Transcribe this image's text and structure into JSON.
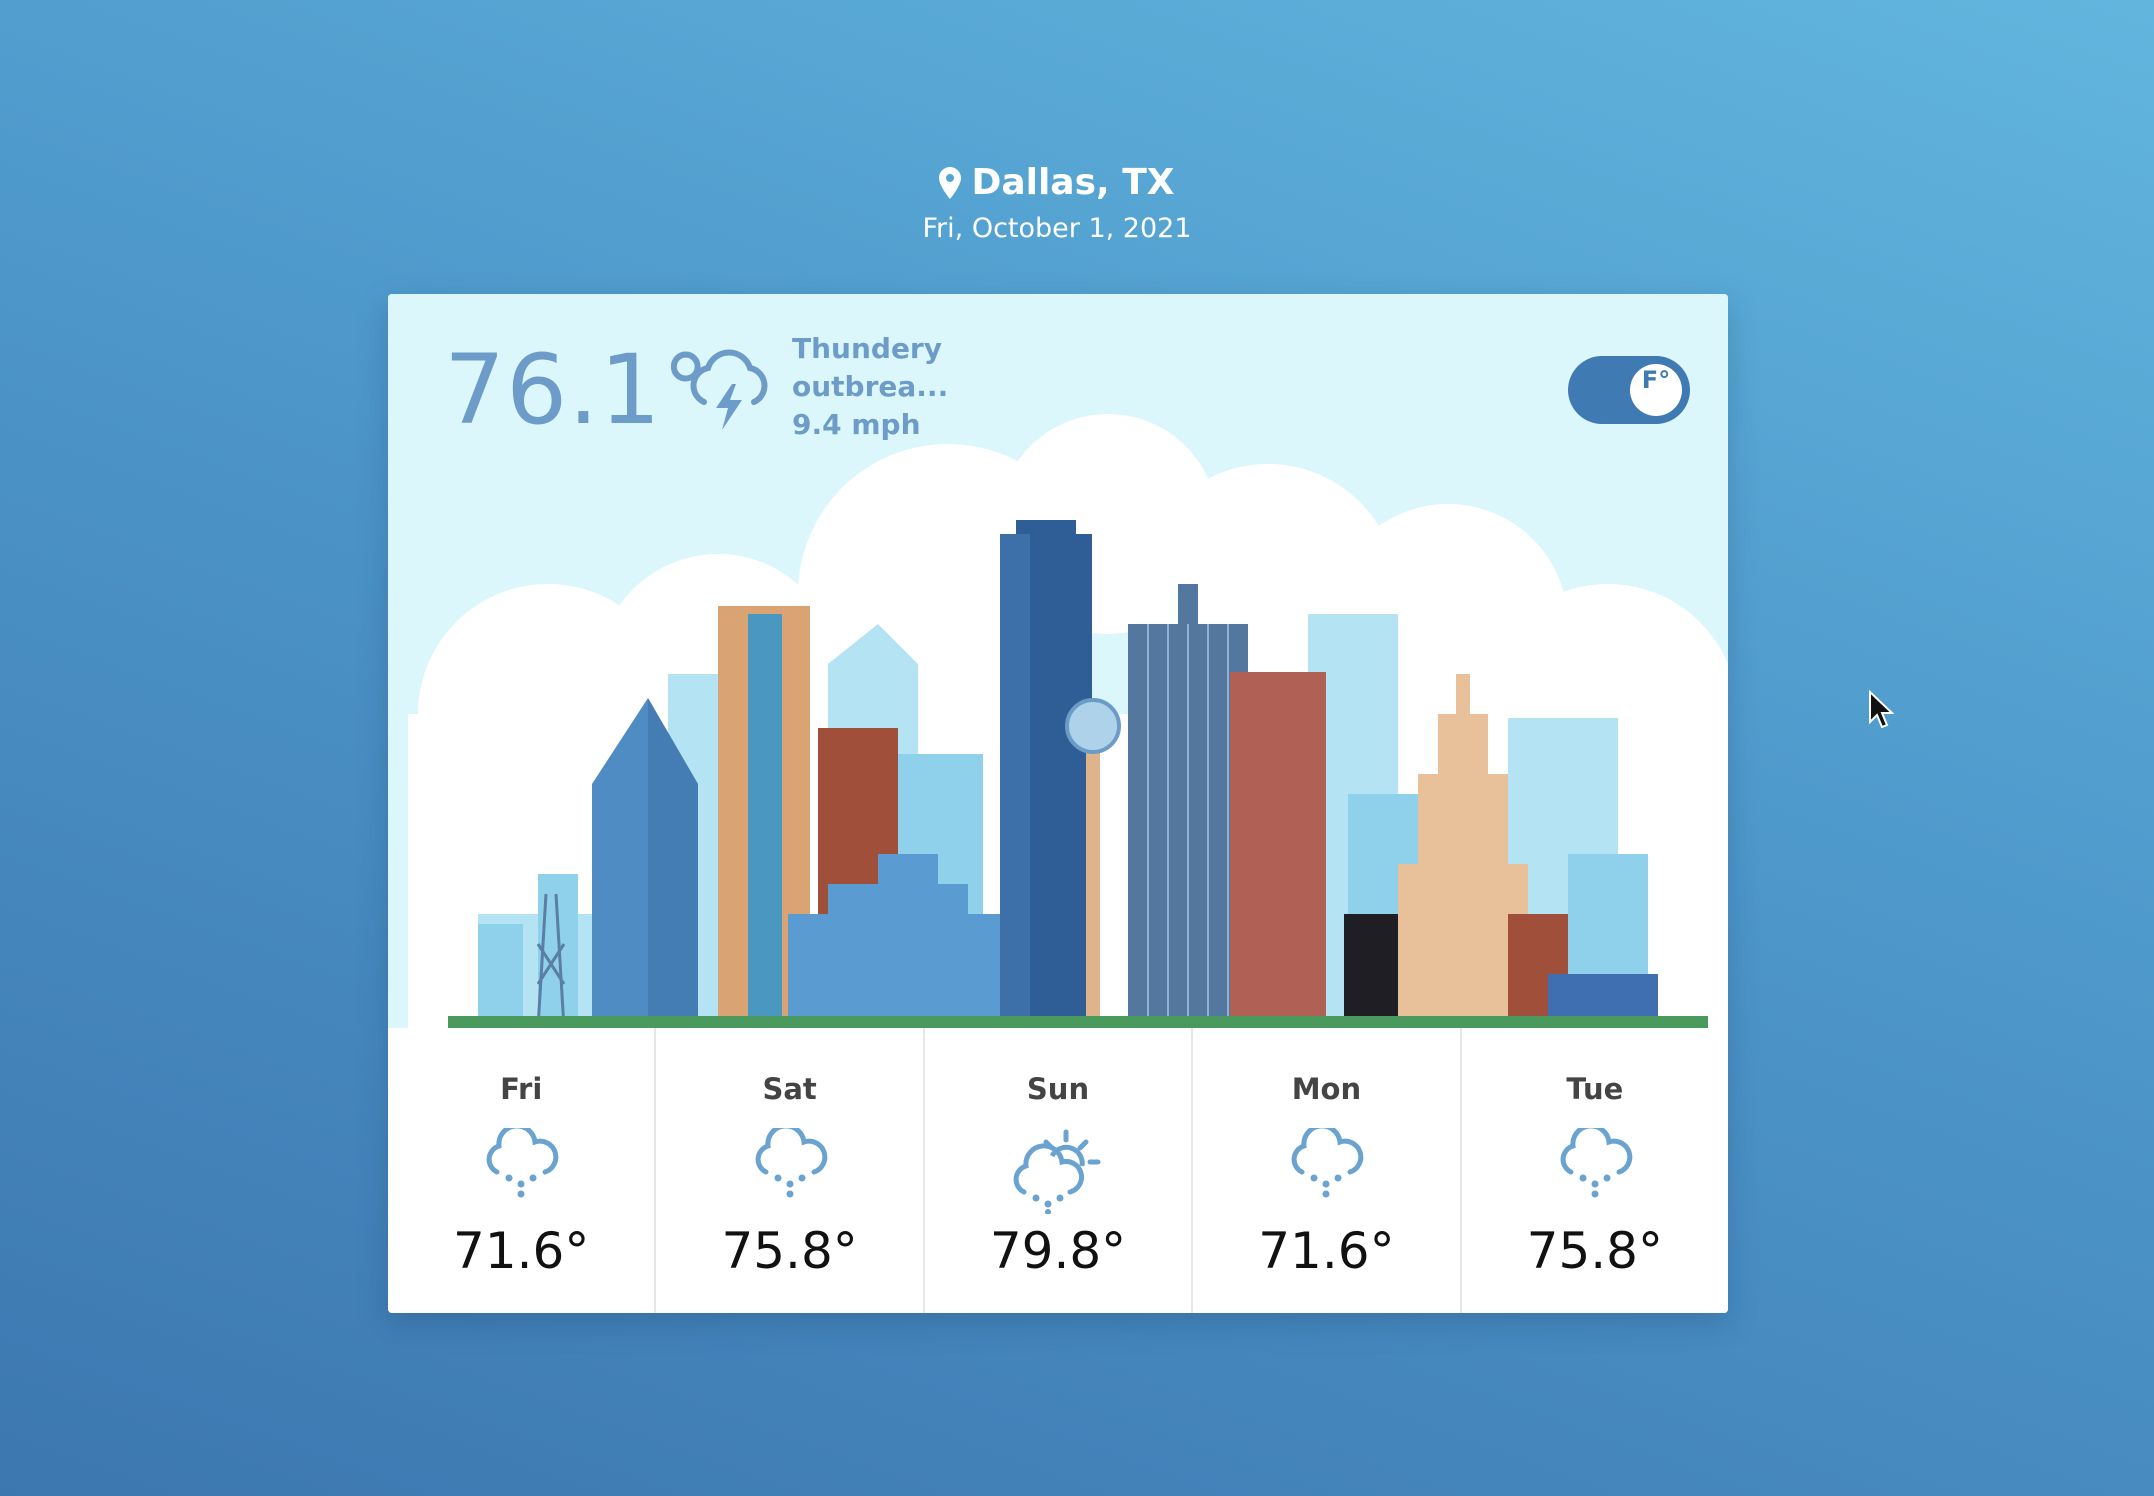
{
  "location": {
    "city": "Dallas, TX",
    "date": "Fri, October 1, 2021",
    "icon": "map-pin-icon"
  },
  "current": {
    "temperature": "76.1°",
    "condition": "Thundery outbrea...",
    "wind": "9.4 mph",
    "icon": "thunderstorm-icon"
  },
  "unit_toggle": {
    "label": "F°",
    "active_unit": "F"
  },
  "forecast": [
    {
      "day": "Fri",
      "temp": "71.6°",
      "icon": "rain-icon"
    },
    {
      "day": "Sat",
      "temp": "75.8°",
      "icon": "rain-icon"
    },
    {
      "day": "Sun",
      "temp": "79.8°",
      "icon": "partly-cloudy-rain-icon"
    },
    {
      "day": "Mon",
      "temp": "71.6°",
      "icon": "rain-icon"
    },
    {
      "day": "Tue",
      "temp": "75.8°",
      "icon": "rain-icon"
    }
  ],
  "colors": {
    "accent": "#3f7ab3",
    "text_soft": "#6d9cc8",
    "sky": "#dcf7fc",
    "icon": "#6aa3cf"
  }
}
